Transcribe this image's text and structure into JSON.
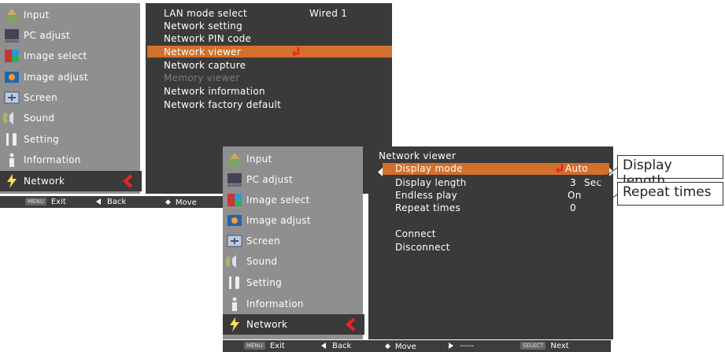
{
  "menu_items": [
    {
      "label": "Input",
      "icon": "input-icon"
    },
    {
      "label": "PC adjust",
      "icon": "pc-adjust-icon"
    },
    {
      "label": "Image select",
      "icon": "image-select-icon"
    },
    {
      "label": "Image adjust",
      "icon": "image-adjust-icon"
    },
    {
      "label": "Screen",
      "icon": "screen-icon"
    },
    {
      "label": "Sound",
      "icon": "sound-icon"
    },
    {
      "label": "Setting",
      "icon": "setting-icon"
    },
    {
      "label": "Information",
      "icon": "information-icon"
    },
    {
      "label": "Network",
      "icon": "network-icon"
    }
  ],
  "menu1": {
    "submenu": [
      {
        "label": "LAN mode select",
        "value": "Wired 1"
      },
      {
        "label": "Network setting"
      },
      {
        "label": "Network PIN code"
      },
      {
        "label": "Network viewer"
      },
      {
        "label": "Network capture"
      },
      {
        "label": "Memory viewer"
      },
      {
        "label": "Network information"
      },
      {
        "label": "Network factory default"
      }
    ],
    "footer": {
      "exit_key": "MENU",
      "exit": "Exit",
      "back": "Back",
      "move": "Move"
    }
  },
  "menu2": {
    "title": "Network viewer",
    "rows": [
      {
        "label": "Display mode",
        "value": "Auto"
      },
      {
        "label": "Display length",
        "value": "3",
        "unit": "Sec"
      },
      {
        "label": "Endless play",
        "value": "On"
      },
      {
        "label": "Repeat times",
        "value": "0"
      },
      {
        "label": "Connect"
      },
      {
        "label": "Disconnect"
      }
    ],
    "footer": {
      "exit_key": "MENU",
      "exit": "Exit",
      "back": "Back",
      "move": "Move",
      "dashes": "-----",
      "next_key": "SELECT",
      "next": "Next"
    }
  },
  "callouts": {
    "display_length": "Display length",
    "repeat_times": "Repeat times"
  },
  "colors": {
    "highlight": "#d2702c",
    "left_panel": "#8f8f8f",
    "right_panel": "#3a3a3a",
    "footer": "#3d3d3d"
  }
}
